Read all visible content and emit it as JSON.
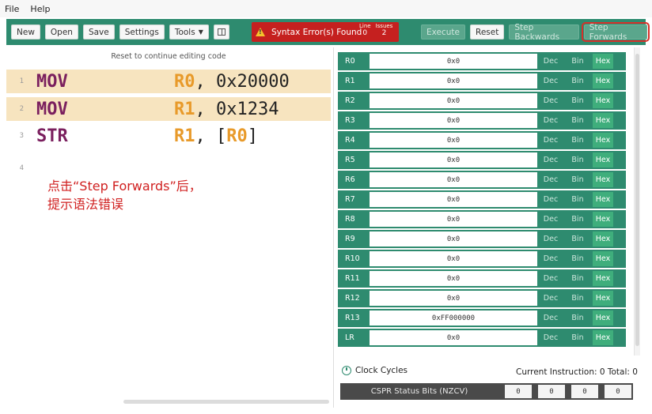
{
  "menu": [
    "File",
    "Help"
  ],
  "toolbar": {
    "new_label": "New",
    "open_label": "Open",
    "save_label": "Save",
    "settings_label": "Settings",
    "tools_label": "Tools",
    "error_text": "Syntax Error(s) Found",
    "line_label": "Line",
    "line_value": "0",
    "issues_label": "Issues",
    "issues_value": "2",
    "execute_label": "Execute",
    "reset_label": "Reset",
    "step_back_label": "Step Backwards",
    "step_forward_label": "Step Forwards"
  },
  "editor": {
    "note": "Reset to continue editing code",
    "lines": [
      {
        "num": "1",
        "op": "MOV",
        "reg": "R0",
        "rest": ", 0x20000"
      },
      {
        "num": "2",
        "op": "MOV",
        "reg": "R1",
        "rest": ", 0x1234"
      },
      {
        "num": "3",
        "op": "STR",
        "reg": "R1",
        "rest": ", [",
        "reg2": "R0",
        "rest2": "]"
      },
      {
        "num": "4"
      }
    ],
    "annotation_line1": "点击“Step Forwards”后，",
    "annotation_line2": "提示语法错误"
  },
  "registers": [
    {
      "name": "R0",
      "value": "0x0"
    },
    {
      "name": "R1",
      "value": "0x0"
    },
    {
      "name": "R2",
      "value": "0x0"
    },
    {
      "name": "R3",
      "value": "0x0"
    },
    {
      "name": "R4",
      "value": "0x0"
    },
    {
      "name": "R5",
      "value": "0x0"
    },
    {
      "name": "R6",
      "value": "0x0"
    },
    {
      "name": "R7",
      "value": "0x0"
    },
    {
      "name": "R8",
      "value": "0x0"
    },
    {
      "name": "R9",
      "value": "0x0"
    },
    {
      "name": "R10",
      "value": "0x0"
    },
    {
      "name": "R11",
      "value": "0x0"
    },
    {
      "name": "R12",
      "value": "0x0"
    },
    {
      "name": "R13",
      "value": "0xFF000000"
    },
    {
      "name": "LR",
      "value": "0x0"
    }
  ],
  "format_labels": {
    "dec": "Dec",
    "bin": "Bin",
    "hex": "Hex"
  },
  "status": {
    "clock_label": "Clock Cycles",
    "current_instruction": "Current Instruction: 0 Total: 0",
    "cpsr_label": "CSPR Status Bits (NZCV)",
    "bits": [
      "0",
      "0",
      "0",
      "0"
    ]
  },
  "colors": {
    "toolbar": "#2e8b6f",
    "error": "#c5201f",
    "highlight": "#f7e4bf",
    "opcode": "#7a1f5e",
    "register": "#e89a2a",
    "annotation": "#d02020"
  }
}
